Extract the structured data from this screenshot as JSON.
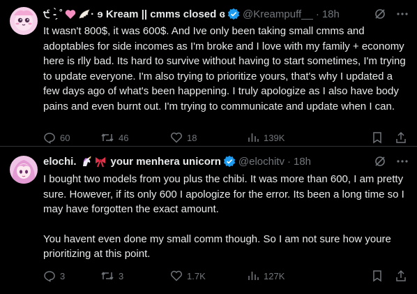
{
  "tweets": [
    {
      "display_name": "੯ -̗̀ ˚",
      "display_name_suffix": " · ɘ Kream || cmms closed ɞ",
      "handle": "@Kreampuff__",
      "time": "18h",
      "body": "It wasn't 800$, it was 600$. And Ive only been taking small cmms and adoptables for side incomes as I'm broke and I love with my family + economy here is rlly bad. Its hard to survive without having to start sometimes, I'm trying to update everyone. I'm also trying to prioritize yours, that's why I updated a few days ago of what's been happening. I truly apologize as I also have body pains and even burnt out. I'm trying to communicate and update when I can.",
      "replies": "60",
      "reposts": "46",
      "likes": "18",
      "views": "139K",
      "avatar_color": "#f3c7e4"
    },
    {
      "display_name": "elochi.",
      "display_name_suffix": "your menhera unicorn",
      "handle": "@elochitv",
      "time": "18h",
      "body_p1": "I bought two models from you plus the chibi. It was more than 600, I am pretty sure. However, if its only 600 I apologize for the error. Its been a long time so I may have forgotten the exact amount.",
      "body_p2": "You havent even done my small comm though. So I am not sure how youre prioritizing at this point.",
      "replies": "3",
      "reposts": "3",
      "likes": "1.7K",
      "views": "127K",
      "avatar_color": "#e8a6d8"
    }
  ],
  "colors": {
    "background": "#000000",
    "text": "#e7e9ea",
    "muted": "#71767b",
    "verified": "#1d9bf0",
    "divider": "#2f3336"
  }
}
